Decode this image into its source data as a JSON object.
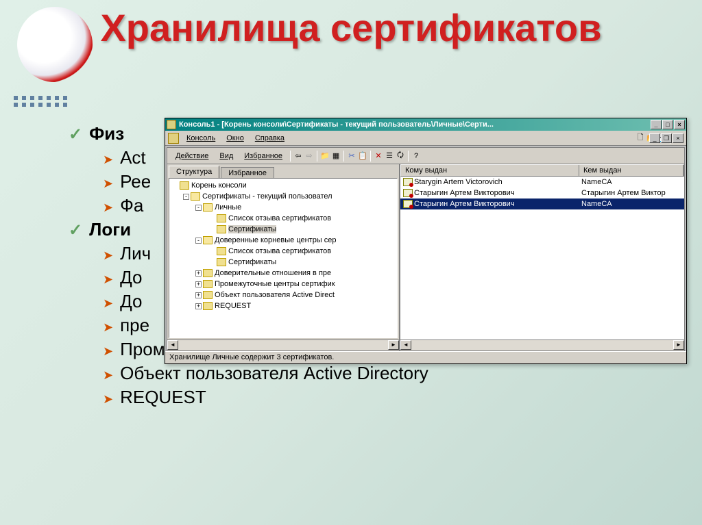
{
  "slide": {
    "title": "Хранилища сертификатов",
    "bullets": {
      "phys": "Физ",
      "phys_items": [
        "Act",
        "Рее",
        "Фа"
      ],
      "logi": "Логи",
      "logi_items_short": [
        "Лич",
        "До",
        "До",
        "пре"
      ],
      "logi_items_full": [
        "Промежуточные центры сертификации",
        "Объект пользователя Active Directory",
        "REQUEST"
      ]
    }
  },
  "mmc": {
    "title": "Консоль1 - [Корень консоли\\Сертификаты - текущий пользователь\\Личные\\Серти...",
    "menu1": [
      "Консоль",
      "Окно",
      "Справка"
    ],
    "menu2": [
      "Действие",
      "Вид",
      "Избранное"
    ],
    "tabs": {
      "structure": "Структура",
      "favorites": "Избранное"
    },
    "tree": [
      {
        "lvl": 1,
        "tog": "",
        "label": "Корень консоли",
        "open": false
      },
      {
        "lvl": 2,
        "tog": "-",
        "label": "Сертификаты - текущий пользовател",
        "open": true
      },
      {
        "lvl": 3,
        "tog": "-",
        "label": "Личные",
        "open": true
      },
      {
        "lvl": 4,
        "tog": "",
        "label": "Список отзыва сертификатов"
      },
      {
        "lvl": 4,
        "tog": "",
        "label": "Сертификаты",
        "selected": true
      },
      {
        "lvl": 3,
        "tog": "-",
        "label": "Доверенные корневые центры сер",
        "open": true
      },
      {
        "lvl": 4,
        "tog": "",
        "label": "Список отзыва сертификатов"
      },
      {
        "lvl": 4,
        "tog": "",
        "label": "Сертификаты"
      },
      {
        "lvl": 3,
        "tog": "+",
        "label": "Доверительные отношения в пре"
      },
      {
        "lvl": 3,
        "tog": "+",
        "label": "Промежуточные центры сертифик"
      },
      {
        "lvl": 3,
        "tog": "+",
        "label": "Объект пользователя Active Direct"
      },
      {
        "lvl": 3,
        "tog": "+",
        "label": "REQUEST"
      }
    ],
    "columns": {
      "issued_to": "Кому выдан",
      "issued_by": "Кем выдан"
    },
    "rows": [
      {
        "to": "Starygin Artem Victorovich",
        "by": "NameCA",
        "sel": false
      },
      {
        "to": "Старыгин Артем Викторович",
        "by": "Старыгин Артем Виктор",
        "sel": false
      },
      {
        "to": "Старыгин Артем Викторович",
        "by": "NameCA",
        "sel": true
      }
    ],
    "status": "Хранилище Личные содержит 3 сертификатов.",
    "col_widths": {
      "to": 260,
      "by": 140
    }
  }
}
